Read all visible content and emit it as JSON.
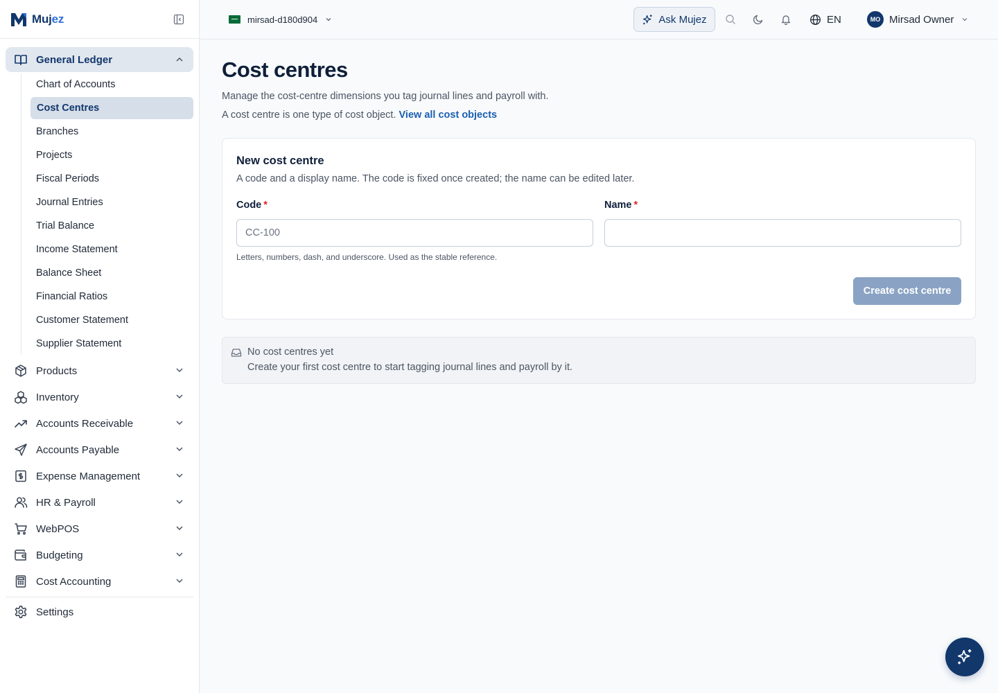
{
  "brand": {
    "name_part1": "Muj",
    "name_part2": "ez"
  },
  "header": {
    "org_name": "mirsad-d180d904",
    "ask_label": "Ask Mujez",
    "language": "EN",
    "user_initials": "MO",
    "user_name": "Mirsad Owner"
  },
  "sidebar": {
    "active_group": {
      "label": "General Ledger",
      "icon": "book-open-icon",
      "items": [
        {
          "label": "Chart of Accounts"
        },
        {
          "label": "Cost Centres",
          "active": true
        },
        {
          "label": "Branches"
        },
        {
          "label": "Projects"
        },
        {
          "label": "Fiscal Periods"
        },
        {
          "label": "Journal Entries"
        },
        {
          "label": "Trial Balance"
        },
        {
          "label": "Income Statement"
        },
        {
          "label": "Balance Sheet"
        },
        {
          "label": "Financial Ratios"
        },
        {
          "label": "Customer Statement"
        },
        {
          "label": "Supplier Statement"
        }
      ]
    },
    "groups": [
      {
        "label": "Products",
        "icon": "package-icon"
      },
      {
        "label": "Inventory",
        "icon": "boxes-icon"
      },
      {
        "label": "Accounts Receivable",
        "icon": "trending-up-icon"
      },
      {
        "label": "Accounts Payable",
        "icon": "send-icon"
      },
      {
        "label": "Expense Management",
        "icon": "receipt-dollar-icon"
      },
      {
        "label": "HR & Payroll",
        "icon": "users-icon"
      },
      {
        "label": "WebPOS",
        "icon": "cart-icon"
      },
      {
        "label": "Budgeting",
        "icon": "wallet-icon"
      },
      {
        "label": "Cost Accounting",
        "icon": "calculator-icon"
      }
    ],
    "settings_label": "Settings"
  },
  "page": {
    "title": "Cost centres",
    "subtitle": "Manage the cost-centre dimensions you tag journal lines and payroll with.",
    "subtitle2_text": "A cost centre is one type of cost object.",
    "subtitle2_link": "View all cost objects"
  },
  "form": {
    "title": "New cost centre",
    "description": "A code and a display name. The code is fixed once created; the name can be edited later.",
    "code_label": "Code",
    "code_placeholder": "CC-100",
    "code_value": "",
    "name_label": "Name",
    "name_placeholder": "",
    "name_value": "",
    "required_mark": "*",
    "code_help": "Letters, numbers, dash, and underscore. Used as the stable reference.",
    "submit_label": "Create cost centre"
  },
  "empty_state": {
    "title": "No cost centres yet",
    "description": "Create your first cost centre to start tagging journal lines and payroll by it."
  },
  "colors": {
    "primary": "#12376b",
    "link": "#1b5fb0",
    "required": "#dc2626",
    "disabled_button": "#8aa3c4",
    "active_nav": "#e1e7ef"
  }
}
